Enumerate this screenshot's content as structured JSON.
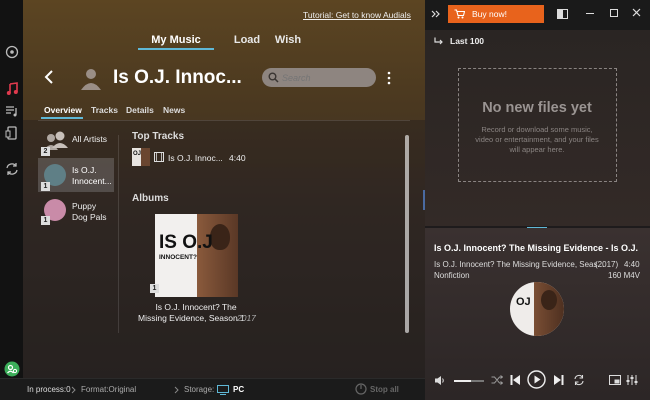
{
  "header": {
    "tutorial_link": "Tutorial: Get to know Audials",
    "tabs": [
      {
        "label": "My Music",
        "active": true
      },
      {
        "label": "Load",
        "active": false
      },
      {
        "label": "Wish",
        "active": false
      }
    ]
  },
  "artist_header": {
    "title": "Is O.J. Innoc...",
    "search_placeholder": "Search"
  },
  "subtabs": [
    {
      "label": "Overview",
      "active": true
    },
    {
      "label": "Tracks",
      "active": false
    },
    {
      "label": "Details",
      "active": false
    },
    {
      "label": "News",
      "active": false
    }
  ],
  "artist_list": [
    {
      "label": "All Artists",
      "badge": "2"
    },
    {
      "label_line1": "Is O.J.",
      "label_line2": "Innocent...",
      "badge": "1",
      "selected": true
    },
    {
      "label_line1": "Puppy",
      "label_line2": "Dog Pals",
      "badge": "1"
    }
  ],
  "top_tracks": {
    "heading": "Top Tracks",
    "tracks": [
      {
        "title": "Is O.J. Innoc...",
        "duration": "4:40"
      }
    ]
  },
  "albums": {
    "heading": "Albums",
    "items": [
      {
        "title_line1": "Is O.J. Innocent? The",
        "title_line2": "Missing Evidence, Season 1",
        "year": "2017",
        "badge": "1",
        "cover_text_1": "IS O.J",
        "cover_text_2": "INNOCENT?"
      }
    ]
  },
  "status_bar": {
    "in_process": "In process:0",
    "format": "Format:Original",
    "storage_label": "Storage:",
    "storage_value": "PC",
    "stop_all": "Stop all"
  },
  "right_panel": {
    "buy_now": "Buy now!",
    "last_label": "Last 100",
    "empty_title": "No new files yet",
    "empty_text_1": "Record or download some music,",
    "empty_text_2": "video or entertainment, and your files",
    "empty_text_3": "will appear here."
  },
  "player": {
    "title": "Is O.J. Innocent? The Missing Evidence - Is O.J.",
    "subtitle": "Is O.J. Innocent? The Missing Evidence, Seas...",
    "year": "(2017)",
    "duration": "4:40",
    "genre": "Nonfiction",
    "size_format": "160 M4V",
    "volume_fraction": 0.55
  },
  "colors": {
    "accent_cyan": "#5fb8d6",
    "buy_orange": "#e8631c",
    "music_red": "#e03a4e",
    "status_green": "#3cae5a"
  }
}
